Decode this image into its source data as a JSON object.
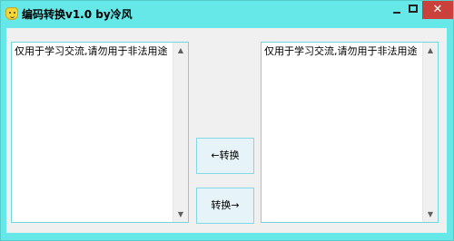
{
  "window": {
    "title": "编码转换v1.0   by冷风",
    "icon": "smiley-face-icon",
    "close_glyph": "✕"
  },
  "left_box": {
    "text": "仅用于学习交流,请勿用于非法用途"
  },
  "right_box": {
    "text": "仅用于学习交流,请勿用于非法用途"
  },
  "buttons": {
    "convert_left": "←转换",
    "convert_right": "转换→"
  },
  "scroll": {
    "up_glyph": "▲",
    "down_glyph": "▼"
  },
  "colors": {
    "frame": "#66e8e8",
    "close_button": "#c9413a",
    "button_border": "#82d8e6",
    "button_bg": "#e6f3f8"
  }
}
